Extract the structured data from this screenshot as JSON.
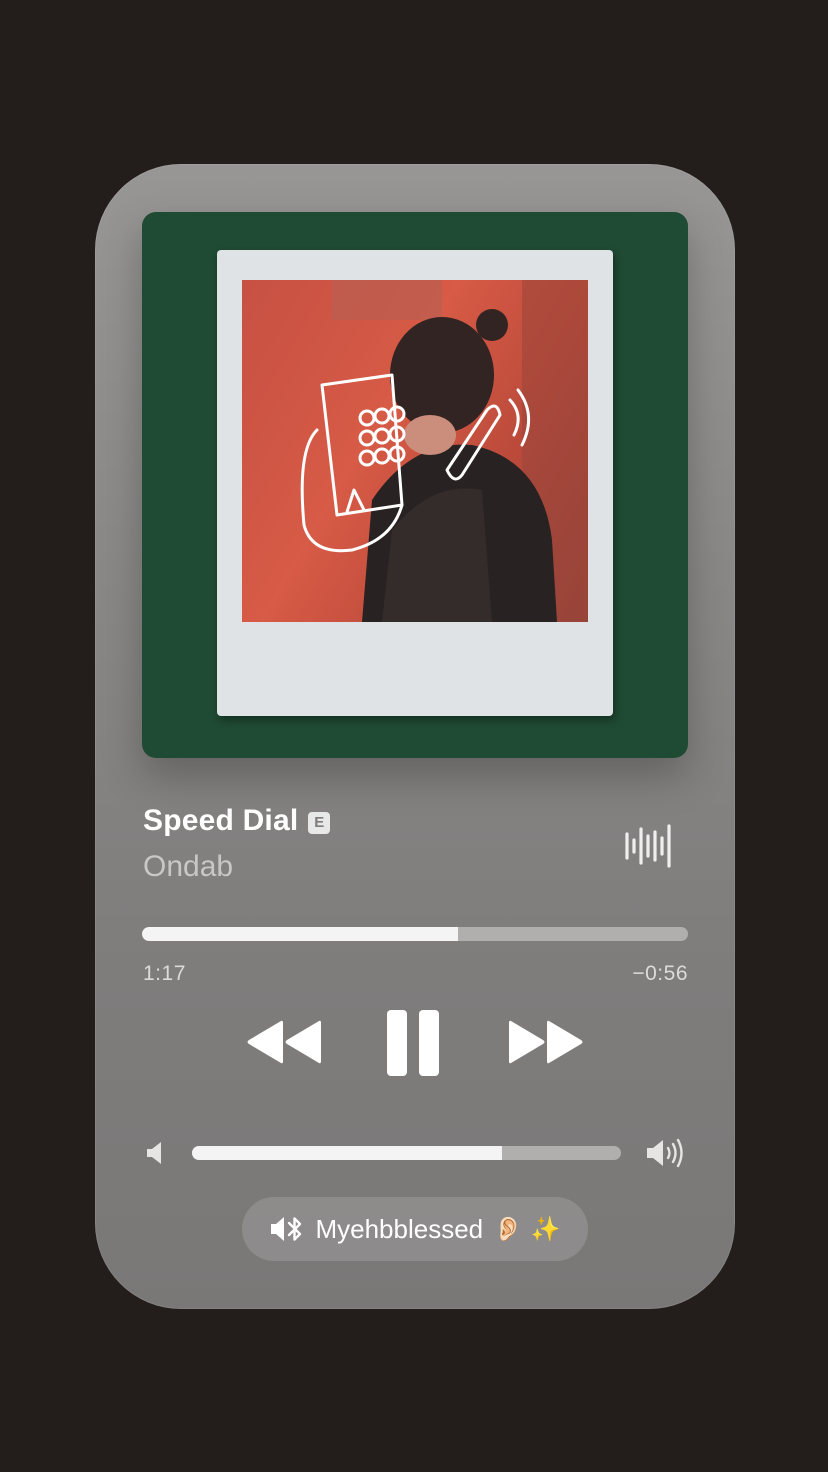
{
  "now_playing": {
    "title": "Speed Dial",
    "explicit_badge": "E",
    "artist": "Ondab",
    "elapsed": "1:17",
    "remaining": "−0:56",
    "progress_percent": 57.8,
    "volume_percent": 72.3
  },
  "icons": {
    "explicit": "explicit-badge",
    "waveform": "waveform-icon",
    "rewind": "rewind-icon",
    "pause": "pause-icon",
    "forward": "fast-forward-icon",
    "volume_low": "speaker-low-icon",
    "volume_high": "speaker-high-icon",
    "output": "bluetooth-speaker-icon"
  },
  "output_device": {
    "name": "Myehbblessed",
    "emoji": "👂🏻 ✨"
  },
  "colors": {
    "background": "#231e1c",
    "artwork_background": "#1f4a33",
    "photo_red": "#c44a3c",
    "track_fill": "#f4f4f4",
    "track_empty": "#b1afae"
  }
}
